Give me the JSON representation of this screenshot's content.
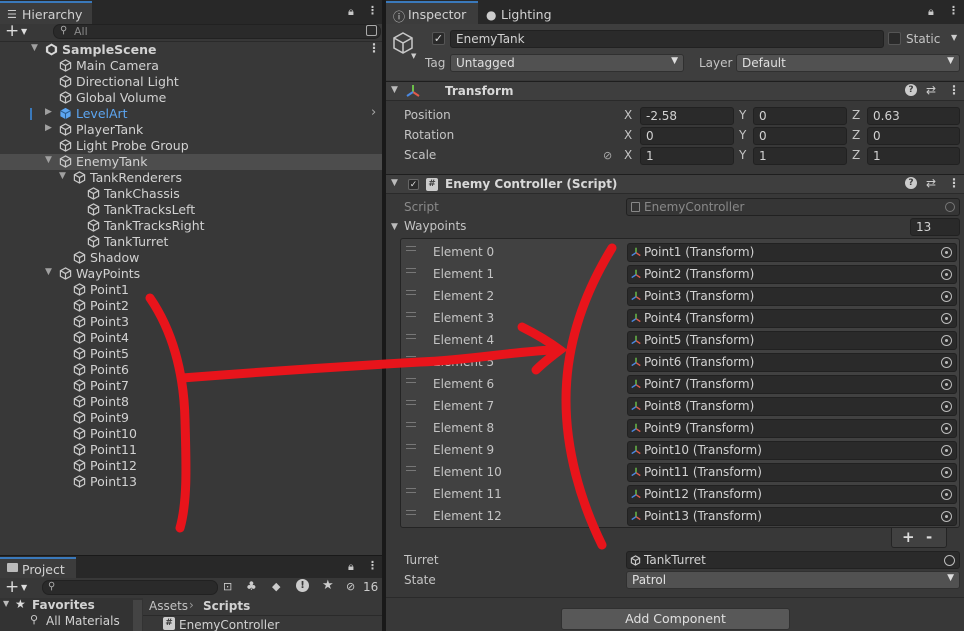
{
  "hierarchy": {
    "tab_label": "Hierarchy",
    "add_label": "+",
    "search_placeholder": "All",
    "items": [
      {
        "label": "SampleScene",
        "depth": 0,
        "type": "scene",
        "fold": "open"
      },
      {
        "label": "Main Camera",
        "depth": 1,
        "type": "go"
      },
      {
        "label": "Directional Light",
        "depth": 1,
        "type": "go"
      },
      {
        "label": "Global Volume",
        "depth": 1,
        "type": "go"
      },
      {
        "label": "LevelArt",
        "depth": 1,
        "type": "prefab",
        "fold": "closed",
        "color": "#5ca5f0"
      },
      {
        "label": "PlayerTank",
        "depth": 1,
        "type": "go",
        "fold": "closed"
      },
      {
        "label": "Light Probe Group",
        "depth": 1,
        "type": "go"
      },
      {
        "label": "EnemyTank",
        "depth": 1,
        "type": "go",
        "fold": "open",
        "selected": true
      },
      {
        "label": "TankRenderers",
        "depth": 2,
        "type": "go",
        "fold": "open"
      },
      {
        "label": "TankChassis",
        "depth": 3,
        "type": "go"
      },
      {
        "label": "TankTracksLeft",
        "depth": 3,
        "type": "go"
      },
      {
        "label": "TankTracksRight",
        "depth": 3,
        "type": "go"
      },
      {
        "label": "TankTurret",
        "depth": 3,
        "type": "go"
      },
      {
        "label": "Shadow",
        "depth": 2,
        "type": "go"
      },
      {
        "label": "WayPoints",
        "depth": 1,
        "type": "go",
        "fold": "open"
      },
      {
        "label": "Point1",
        "depth": 2,
        "type": "go"
      },
      {
        "label": "Point2",
        "depth": 2,
        "type": "go"
      },
      {
        "label": "Point3",
        "depth": 2,
        "type": "go"
      },
      {
        "label": "Point4",
        "depth": 2,
        "type": "go"
      },
      {
        "label": "Point5",
        "depth": 2,
        "type": "go"
      },
      {
        "label": "Point6",
        "depth": 2,
        "type": "go"
      },
      {
        "label": "Point7",
        "depth": 2,
        "type": "go"
      },
      {
        "label": "Point8",
        "depth": 2,
        "type": "go"
      },
      {
        "label": "Point9",
        "depth": 2,
        "type": "go"
      },
      {
        "label": "Point10",
        "depth": 2,
        "type": "go"
      },
      {
        "label": "Point11",
        "depth": 2,
        "type": "go"
      },
      {
        "label": "Point12",
        "depth": 2,
        "type": "go"
      },
      {
        "label": "Point13",
        "depth": 2,
        "type": "go"
      }
    ]
  },
  "project": {
    "tab_label": "Project",
    "add_label": "+",
    "hidden_count": "16",
    "favorites_label": "Favorites",
    "favorites_item": "All Materials",
    "breadcrumb": [
      "Assets",
      "Scripts"
    ],
    "file": "EnemyController"
  },
  "inspector": {
    "tabs": [
      "Inspector",
      "Lighting"
    ],
    "object_name": "EnemyTank",
    "static_label": "Static",
    "tag_label": "Tag",
    "tag_value": "Untagged",
    "layer_label": "Layer",
    "layer_value": "Default",
    "transform": {
      "title": "Transform",
      "rows": [
        {
          "label": "Position",
          "x": "-2.58",
          "y": "0",
          "z": "0.63"
        },
        {
          "label": "Rotation",
          "x": "0",
          "y": "0",
          "z": "0"
        },
        {
          "label": "Scale",
          "x": "1",
          "y": "1",
          "z": "1"
        }
      ],
      "axis": [
        "X",
        "Y",
        "Z"
      ]
    },
    "controller": {
      "title": "Enemy Controller (Script)",
      "script_label": "Script",
      "script_value": "EnemyController",
      "waypoints_label": "Waypoints",
      "waypoints_count": "13",
      "elements": [
        {
          "label": "Element 0",
          "value": "Point1 (Transform)"
        },
        {
          "label": "Element 1",
          "value": "Point2 (Transform)"
        },
        {
          "label": "Element 2",
          "value": "Point3 (Transform)"
        },
        {
          "label": "Element 3",
          "value": "Point4 (Transform)"
        },
        {
          "label": "Element 4",
          "value": "Point5 (Transform)"
        },
        {
          "label": "Element 5",
          "value": "Point6 (Transform)"
        },
        {
          "label": "Element 6",
          "value": "Point7 (Transform)"
        },
        {
          "label": "Element 7",
          "value": "Point8 (Transform)"
        },
        {
          "label": "Element 8",
          "value": "Point9 (Transform)"
        },
        {
          "label": "Element 9",
          "value": "Point10 (Transform)"
        },
        {
          "label": "Element 10",
          "value": "Point11 (Transform)"
        },
        {
          "label": "Element 11",
          "value": "Point12 (Transform)"
        },
        {
          "label": "Element 12",
          "value": "Point13 (Transform)"
        }
      ],
      "plus_label": "+",
      "minus_label": "-",
      "turret_label": "Turret",
      "turret_value": "TankTurret",
      "state_label": "State",
      "state_value": "Patrol"
    },
    "add_component_label": "Add Component"
  },
  "colors": {
    "annotation": "#e8141b",
    "accent": "#3a79bb",
    "prefab": "#5ca5f0"
  }
}
